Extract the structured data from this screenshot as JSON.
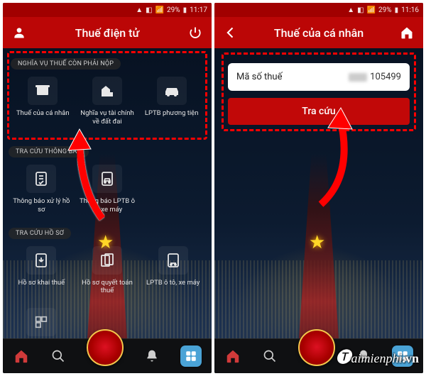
{
  "statusbar": {
    "battery": "29%",
    "time_left": "11:17",
    "time_right": "11:16"
  },
  "screen1": {
    "title": "Thuế điện tử",
    "sections": {
      "obligation": {
        "label": "NGHĨA VỤ THUẾ CÒN PHẢI NỘP",
        "items": [
          {
            "label": "Thuế của cá nhân"
          },
          {
            "label": "Nghĩa vụ tài chính về đất đai"
          },
          {
            "label": "LPTB phương tiện"
          }
        ]
      },
      "notice": {
        "label": "TRA CỨU THÔNG BÁO",
        "items": [
          {
            "label": "Thông báo xử lý hồ sơ"
          },
          {
            "label": "Thông báo LPTB ô tô, xe máy"
          }
        ]
      },
      "dossier": {
        "label": "TRA CỨU HỒ SƠ",
        "items": [
          {
            "label": "Hồ sơ khai thuế"
          },
          {
            "label": "Hồ sơ quyết toán thuế"
          },
          {
            "label": "LPTB ô tô, xe máy"
          }
        ]
      }
    }
  },
  "screen2": {
    "title": "Thuế của cá nhân",
    "field_label": "Mã số thuế",
    "field_value": "105499",
    "button": "Tra cứu"
  },
  "watermark": "aimienphi",
  "watermark_suffix": ".vn"
}
